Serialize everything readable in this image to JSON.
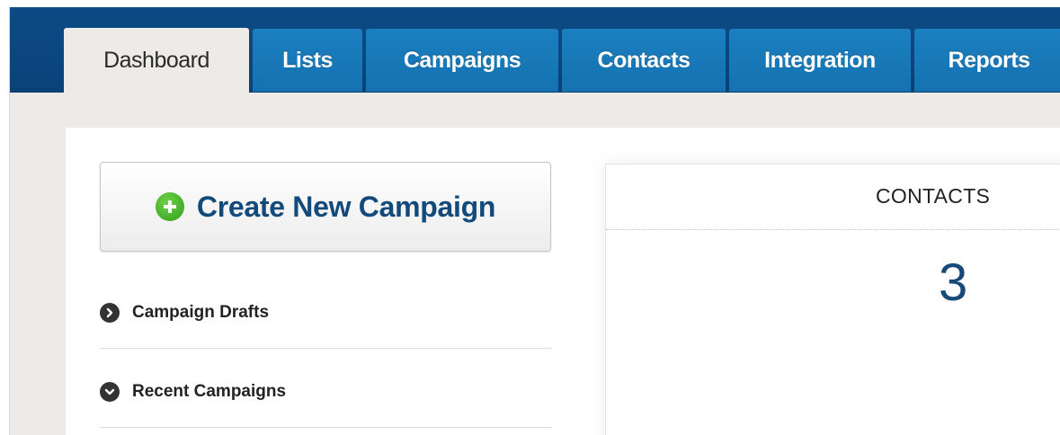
{
  "nav": {
    "tabs": [
      {
        "label": "Dashboard",
        "active": true
      },
      {
        "label": "Lists",
        "active": false
      },
      {
        "label": "Campaigns",
        "active": false
      },
      {
        "label": "Contacts",
        "active": false
      },
      {
        "label": "Integration",
        "active": false
      },
      {
        "label": "Reports",
        "active": false
      }
    ]
  },
  "sidebar": {
    "create_button_label": "Create New Campaign",
    "sections": [
      {
        "label": "Campaign Drafts",
        "icon": "chevron-right-circle-icon"
      },
      {
        "label": "Recent Campaigns",
        "icon": "chevron-down-circle-icon"
      }
    ]
  },
  "contacts_widget": {
    "title": "CONTACTS",
    "count": "3"
  },
  "colors": {
    "nav_bar": "#0d4b86",
    "tab": "#1b7fc0",
    "active_tab": "#ecebe8",
    "create_text": "#134a7c",
    "plus_icon": "#3aaa22",
    "count_text": "#174a78"
  }
}
